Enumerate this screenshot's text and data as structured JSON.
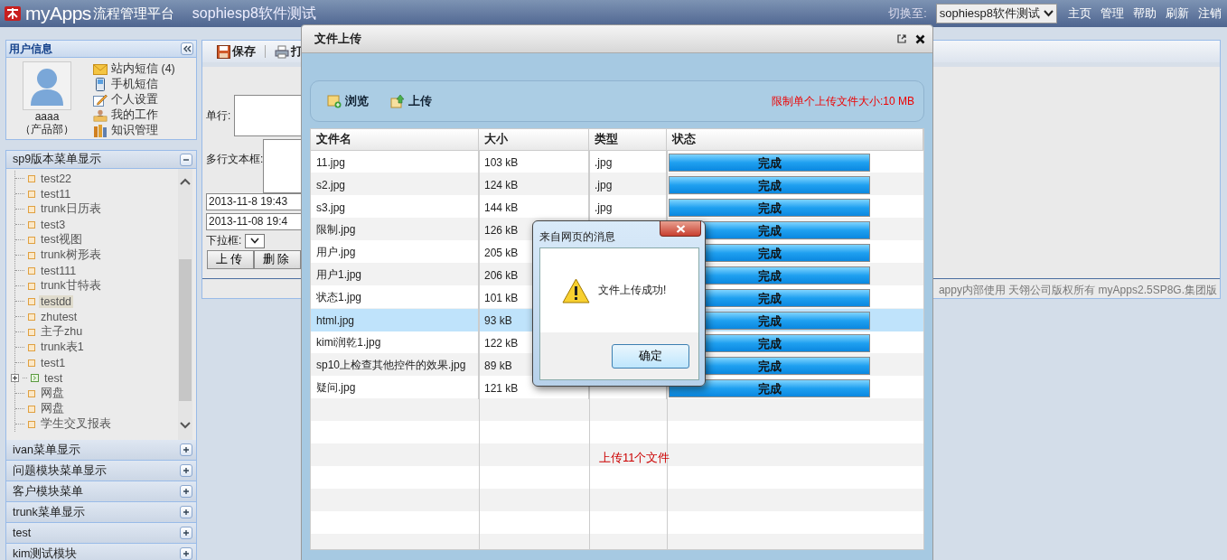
{
  "header": {
    "logo": "myApps",
    "logo_suffix": "流程管理平台",
    "app_title": "sophiesp8软件测试",
    "switch_label": "切换至:",
    "switch_value": "sophiesp8软件测试",
    "links": [
      "主页",
      "管理",
      "帮助",
      "刷新",
      "注销"
    ]
  },
  "user_panel": {
    "title": "用户信息",
    "name": "aaaa",
    "department": "（产品部）",
    "links": [
      {
        "label": "站内短信 (4)",
        "kind": "mail"
      },
      {
        "label": "手机短信",
        "kind": "phone"
      },
      {
        "label": "个人设置",
        "kind": "settings"
      },
      {
        "label": "我的工作",
        "kind": "work"
      },
      {
        "label": "知识管理",
        "kind": "knowledge"
      }
    ]
  },
  "menus": [
    {
      "title": "sp9版本菜单显示",
      "expanded": true,
      "items": [
        {
          "label": "test22",
          "kind": "page",
          "selected": false
        },
        {
          "label": "test11",
          "kind": "page",
          "selected": false
        },
        {
          "label": "trunk日历表",
          "kind": "page",
          "selected": false
        },
        {
          "label": "test3",
          "kind": "page",
          "selected": false
        },
        {
          "label": "test视图",
          "kind": "page",
          "selected": false
        },
        {
          "label": "trunk树形表",
          "kind": "page",
          "selected": false
        },
        {
          "label": "test111",
          "kind": "page",
          "selected": false
        },
        {
          "label": "trunk甘特表",
          "kind": "page",
          "selected": false
        },
        {
          "label": "testdd",
          "kind": "page",
          "selected": true
        },
        {
          "label": "zhutest",
          "kind": "page",
          "selected": false
        },
        {
          "label": "主子zhu",
          "kind": "page",
          "selected": false
        },
        {
          "label": "trunk表1",
          "kind": "page",
          "selected": false
        },
        {
          "label": "test1",
          "kind": "page",
          "selected": false
        },
        {
          "label": "test",
          "kind": "folder",
          "selected": false
        },
        {
          "label": "网盘",
          "kind": "page",
          "selected": false
        },
        {
          "label": "网盘",
          "kind": "page",
          "selected": false
        },
        {
          "label": "学生交叉报表",
          "kind": "page",
          "selected": false
        }
      ]
    },
    {
      "title": "ivan菜单显示",
      "expanded": false
    },
    {
      "title": "问题模块菜单显示",
      "expanded": false
    },
    {
      "title": "客户模块菜单",
      "expanded": false
    },
    {
      "title": "trunk菜单显示",
      "expanded": false
    },
    {
      "title": "test",
      "expanded": false
    },
    {
      "title": "kim测试模块",
      "expanded": false
    }
  ],
  "toolbar": [
    {
      "label": "保存",
      "kind": "save"
    },
    {
      "label": "打",
      "kind": "print"
    }
  ],
  "form": {
    "single_line_label": "单行:",
    "multiline_label": "多行文本框:",
    "date_1": "2013-11-8 19:43",
    "date_2": "2013-11-08 19:4",
    "dropdown_label": "下拉框:",
    "buttons": [
      "上传",
      "删除"
    ]
  },
  "footer": "appy内部使用 天翎公司版权所有 myApps2.5SP8G.集团版",
  "upload_dialog": {
    "title": "文件上传",
    "actions": [
      {
        "label": "浏览",
        "kind": "browse"
      },
      {
        "label": "上传",
        "kind": "upload"
      }
    ],
    "limit_note": "限制单个上传文件大小:10 MB",
    "columns": [
      "文件名",
      "大小",
      "类型",
      "状态"
    ],
    "files": [
      {
        "name": "11.jpg",
        "size": "103 kB",
        "type": ".jpg",
        "status": "完成",
        "level": 1,
        "selected": false
      },
      {
        "name": "s2.jpg",
        "size": "124 kB",
        "type": ".jpg",
        "status": "完成",
        "level": 1,
        "selected": false
      },
      {
        "name": "s3.jpg",
        "size": "144 kB",
        "type": ".jpg",
        "status": "完成",
        "level": 1,
        "selected": false
      },
      {
        "name": "限制.jpg",
        "size": "126 kB",
        "status": "完成",
        "level": 1,
        "selected": false
      },
      {
        "name": "用户.jpg",
        "size": "205 kB",
        "status": "完成",
        "level": 1,
        "selected": false
      },
      {
        "name": "用户1.jpg",
        "size": "206 kB",
        "status": "完成",
        "level": 1,
        "selected": false
      },
      {
        "name": "状态1.jpg",
        "size": "101 kB",
        "status": "完成",
        "level": 1,
        "selected": false
      },
      {
        "name": "html.jpg",
        "size": "93 kB",
        "status": "完成",
        "level": 1,
        "selected": true
      },
      {
        "name": "kimi润乾1.jpg",
        "size": "122 kB",
        "status": "完成",
        "level": 1,
        "selected": false
      },
      {
        "name": "sp10上检查其他控件的效果.jpg",
        "size": "89 kB",
        "status": "完成",
        "level": 1,
        "selected": false
      },
      {
        "name": "疑问.jpg",
        "size": "121 kB",
        "status": "完成",
        "level": 1,
        "selected": false
      }
    ],
    "summary": "上传11个文件"
  },
  "message_box": {
    "title": "来自网页的消息",
    "message": "文件上传成功!",
    "button": "确定"
  }
}
